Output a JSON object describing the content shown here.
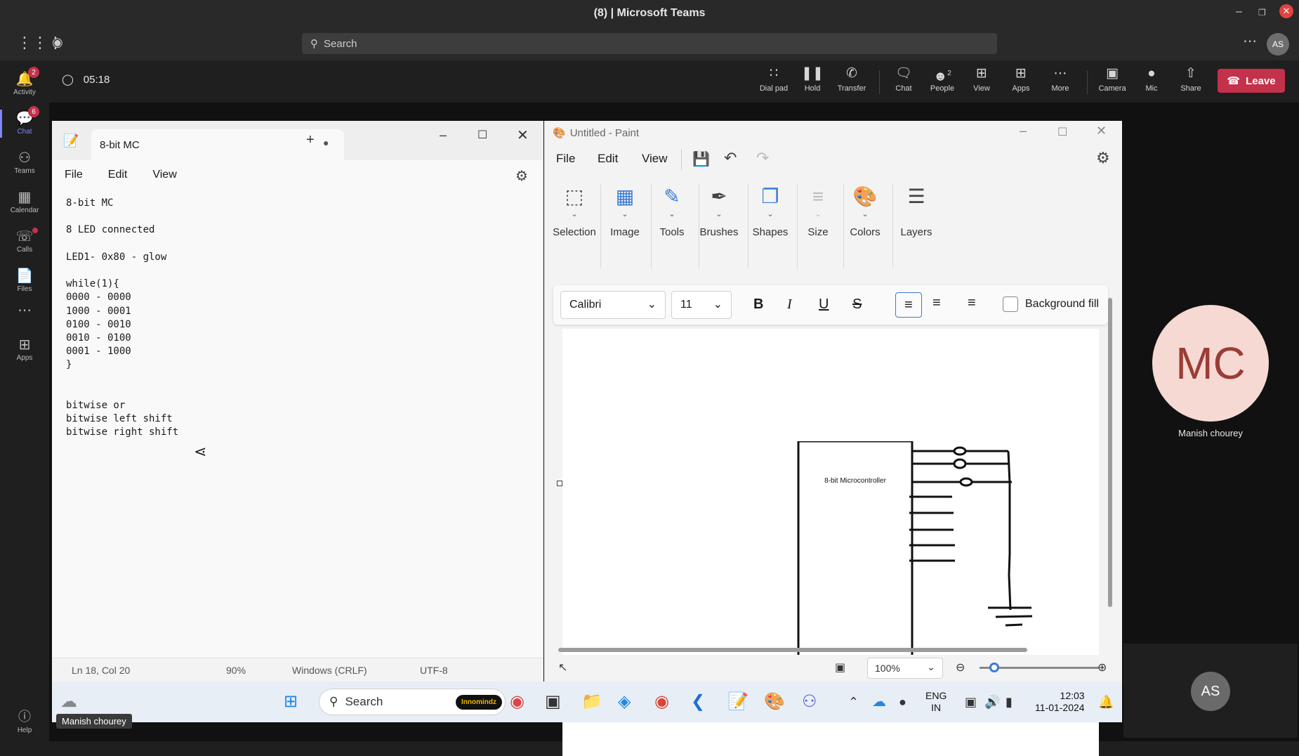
{
  "window": {
    "title": "(8) | Microsoft Teams"
  },
  "search": {
    "placeholder": "Search"
  },
  "user_initials": "AS",
  "rail": {
    "items": [
      {
        "label": "Activity",
        "badge": "2",
        "icon": "bell-icon"
      },
      {
        "label": "Chat",
        "badge": "6",
        "icon": "chat-icon"
      },
      {
        "label": "Teams",
        "badge": "",
        "icon": "teams-icon"
      },
      {
        "label": "Calendar",
        "badge": "",
        "icon": "calendar-icon"
      },
      {
        "label": "Calls",
        "badge": "",
        "icon": "phone-icon"
      },
      {
        "label": "Files",
        "badge": "",
        "icon": "file-icon"
      },
      {
        "label": "",
        "badge": "",
        "icon": "more-icon"
      },
      {
        "label": "Apps",
        "badge": "",
        "icon": "apps-icon"
      }
    ],
    "help_label": "Help"
  },
  "call": {
    "timer": "05:18",
    "buttons": [
      {
        "label": "Dial pad",
        "icon": "dialpad-icon"
      },
      {
        "label": "Hold",
        "icon": "pause-icon"
      },
      {
        "label": "Transfer",
        "icon": "transfer-icon"
      },
      {
        "label": "Chat",
        "icon": "chat-icon"
      },
      {
        "label": "People",
        "icon": "people-icon",
        "count": "2"
      },
      {
        "label": "View",
        "icon": "grid-icon"
      },
      {
        "label": "Apps",
        "icon": "plus-icon"
      },
      {
        "label": "More",
        "icon": "more-icon"
      },
      {
        "label": "Camera",
        "icon": "camera-off-icon"
      },
      {
        "label": "Mic",
        "icon": "mic-icon"
      },
      {
        "label": "Share",
        "icon": "share-icon"
      }
    ],
    "leave_label": "Leave"
  },
  "notepad": {
    "tab_title": "8-bit MC",
    "menu": [
      "File",
      "Edit",
      "View"
    ],
    "lines": [
      "8-bit MC",
      "",
      "8 LED connected",
      "",
      "LED1- 0x80 - glow",
      "",
      "while(1){",
      "0000 - 0000",
      "1000 - 0001",
      "0100 - 0010",
      "0010 - 0100",
      "0001 - 1000",
      "}",
      "",
      "",
      "bitwise or",
      "bitwise left shift",
      "bitwise right shift"
    ],
    "status": {
      "position": "Ln 18, Col 20",
      "zoom": "90%",
      "line_ending": "Windows (CRLF)",
      "encoding": "UTF-8"
    }
  },
  "paint": {
    "title": "Untitled - Paint",
    "menu": [
      "File",
      "Edit",
      "View"
    ],
    "tools": [
      "Selection",
      "Image",
      "Tools",
      "Brushes",
      "Shapes",
      "Size",
      "Colors",
      "Layers"
    ],
    "font": "Calibri",
    "font_size": "11",
    "background_fill_label": "Background fill",
    "canvas_text": "8-bit Microcontroller",
    "zoom": "100%"
  },
  "participants": {
    "main": {
      "initials": "MC",
      "name": "Manish chourey"
    },
    "self": {
      "initials": "AS"
    },
    "presenter": "Manish chourey"
  },
  "taskbar": {
    "search": "Search",
    "search_badge": "Innomindz",
    "lang": "ENG",
    "region": "IN",
    "time": "12:03",
    "date": "11-01-2024"
  },
  "colors": {
    "accent": "#7f85f5",
    "leave": "#c4314b",
    "mc_bg": "#f7d9d4",
    "mc_fg": "#9a3d35"
  }
}
